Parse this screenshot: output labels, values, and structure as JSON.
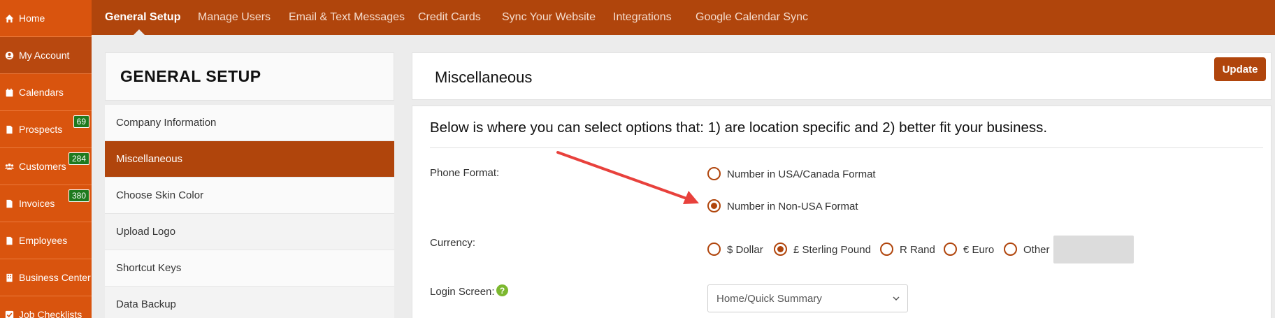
{
  "sidebar": {
    "items": [
      {
        "label": "Home",
        "icon": "home-icon"
      },
      {
        "label": "My Account",
        "icon": "user-circle-icon"
      },
      {
        "label": "Calendars",
        "icon": "calendar-icon"
      },
      {
        "label": "Prospects",
        "icon": "file-icon",
        "badge": "69"
      },
      {
        "label": "Customers",
        "icon": "users-icon",
        "badge": "284"
      },
      {
        "label": "Invoices",
        "icon": "file-icon",
        "badge": "380"
      },
      {
        "label": "Employees",
        "icon": "file-icon"
      },
      {
        "label": "Business Center",
        "icon": "building-icon"
      },
      {
        "label": "Job Checklists",
        "icon": "checkbox-icon"
      }
    ]
  },
  "topnav": {
    "tabs": [
      {
        "label": "General Setup",
        "active": true
      },
      {
        "label": "Manage Users"
      },
      {
        "label": "Email & Text Messages"
      },
      {
        "label": "Credit Cards"
      },
      {
        "label": "Sync Your Website"
      },
      {
        "label": "Integrations"
      },
      {
        "label": "Google Calendar Sync"
      }
    ]
  },
  "left_panel": {
    "title": "GENERAL SETUP",
    "menu": [
      {
        "label": "Company Information"
      },
      {
        "label": "Miscellaneous",
        "active": true
      },
      {
        "label": "Choose Skin Color"
      },
      {
        "label": "Upload Logo"
      },
      {
        "label": "Shortcut Keys"
      },
      {
        "label": "Data Backup"
      }
    ]
  },
  "main": {
    "title": "Miscellaneous",
    "update_label": "Update",
    "intro": "Below is where you can select options that: 1) are location specific and 2) better fit your business.",
    "phone_format": {
      "label": "Phone Format:",
      "options": [
        {
          "label": "Number in USA/Canada Format",
          "checked": false
        },
        {
          "label": "Number in Non-USA Format",
          "checked": true
        }
      ]
    },
    "currency": {
      "label": "Currency:",
      "options": [
        {
          "label": "$ Dollar",
          "checked": false
        },
        {
          "label": "£ Sterling Pound",
          "checked": true
        },
        {
          "label": "R Rand",
          "checked": false
        },
        {
          "label": "€ Euro",
          "checked": false
        },
        {
          "label": "Other",
          "checked": false
        }
      ],
      "other_value": ""
    },
    "login_screen": {
      "label": "Login Screen:",
      "help": "?",
      "selected": "Home/Quick Summary"
    }
  },
  "colors": {
    "sidebar": "#d9540e",
    "topbar": "#b0450c",
    "accent": "#b0450c",
    "badge": "#1e7a1e",
    "annotation_arrow": "#e8413c"
  }
}
